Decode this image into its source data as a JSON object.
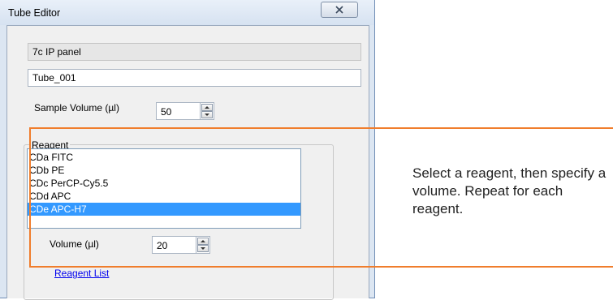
{
  "window": {
    "title": "Tube Editor",
    "close_icon": "close-icon"
  },
  "panel_name": "7c IP panel",
  "tube_name": "Tube_001",
  "sample_volume": {
    "label": "Sample Volume (µl)",
    "value": "50"
  },
  "reagent_group": {
    "label": "Reagent",
    "items": [
      {
        "label": "CDa FITC",
        "selected": false
      },
      {
        "label": "CDb PE",
        "selected": false
      },
      {
        "label": "CDc PerCP-Cy5.5",
        "selected": false
      },
      {
        "label": "CDd APC",
        "selected": false
      },
      {
        "label": "CDe APC-H7",
        "selected": true
      }
    ],
    "volume_label": "Volume (µl)",
    "volume_value": "20",
    "reagent_list_link": "Reagent List"
  },
  "callout": {
    "text": "Select a reagent, then specify a volume. Repeat for each reagent.",
    "color": "#f07d2c"
  },
  "colors": {
    "selection": "#3399ff",
    "link": "#0000ee"
  }
}
